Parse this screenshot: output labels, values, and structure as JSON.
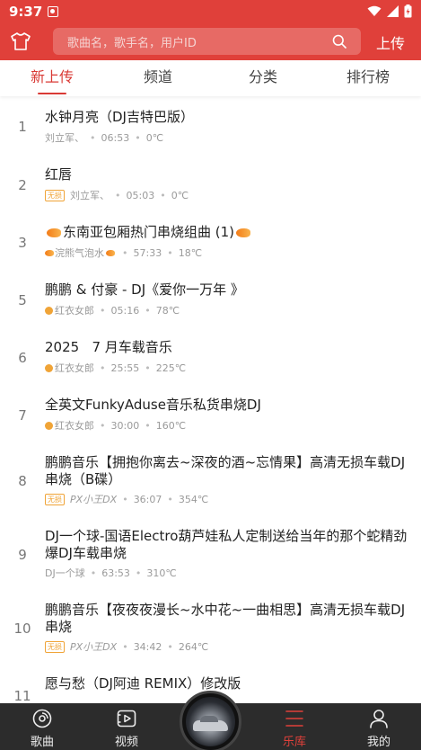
{
  "status_bar": {
    "time": "9:37"
  },
  "header": {
    "search_placeholder": "歌曲名，歌手名，用户ID",
    "upload_label": "上传"
  },
  "tabs": [
    {
      "label": "新上传",
      "active": true
    },
    {
      "label": "频道",
      "active": false
    },
    {
      "label": "分类",
      "active": false
    },
    {
      "label": "排行榜",
      "active": false
    }
  ],
  "songs": [
    {
      "rank": "1",
      "title": "水钟月亮（DJ吉特巴版）",
      "user": "刘立军、",
      "duration": "06:53",
      "temp": "0℃",
      "badge": ""
    },
    {
      "rank": "2",
      "title": "红唇",
      "user": "刘立军、",
      "duration": "05:03",
      "temp": "0℃",
      "badge": "无损"
    },
    {
      "rank": "3",
      "title": "东南亚包厢热门串烧组曲 (1)",
      "user": "浣熊气泡水",
      "duration": "57:33",
      "temp": "18℃",
      "badge": ""
    },
    {
      "rank": "5",
      "title": "鹏鹏 & 付豪 - DJ《爱你一万年 》",
      "user": "红衣女郎",
      "duration": "05:16",
      "temp": "78℃",
      "badge": ""
    },
    {
      "rank": "6",
      "title": "2025   7 月车载音乐",
      "user": "红衣女郎",
      "duration": "25:55",
      "temp": "225℃",
      "badge": ""
    },
    {
      "rank": "7",
      "title": "全英文FunkyAduse音乐私货串烧DJ",
      "user": "红衣女郎",
      "duration": "30:00",
      "temp": "160℃",
      "badge": ""
    },
    {
      "rank": "8",
      "title": "鹏鹏音乐【拥抱你离去~深夜的酒~忘情果】高清无损车载DJ串烧（B碟）",
      "user": "PX小王DX",
      "duration": "36:07",
      "temp": "354℃",
      "badge": "无损"
    },
    {
      "rank": "9",
      "title": "DJ一个球-国语Electro葫芦娃私人定制送给当年的那个蛇精劲爆DJ车载串烧",
      "user": "DJ一个球",
      "duration": "63:53",
      "temp": "310℃",
      "badge": ""
    },
    {
      "rank": "10",
      "title": "鹏鹏音乐【夜夜夜漫长~水中花~一曲相思】高清无损车载DJ串烧",
      "user": "PX小王DX",
      "duration": "34:42",
      "temp": "264℃",
      "badge": "无损"
    },
    {
      "rank": "11",
      "title": "愿与愁（DJ阿迪 REMIX）修改版",
      "user": "",
      "duration": "",
      "temp": "",
      "badge": ""
    }
  ],
  "bottom_nav": [
    {
      "label": "歌曲",
      "icon": "disc-icon",
      "active": false
    },
    {
      "label": "视频",
      "icon": "video-icon",
      "active": false
    },
    {
      "label": "乐库",
      "icon": "library-icon",
      "active": true
    },
    {
      "label": "我的",
      "icon": "user-icon",
      "active": false
    }
  ],
  "colors": {
    "brand": "#e0403a",
    "active_tab": "#d93a35",
    "nav_bg": "#2c2c2c",
    "badge": "#f0a437"
  }
}
